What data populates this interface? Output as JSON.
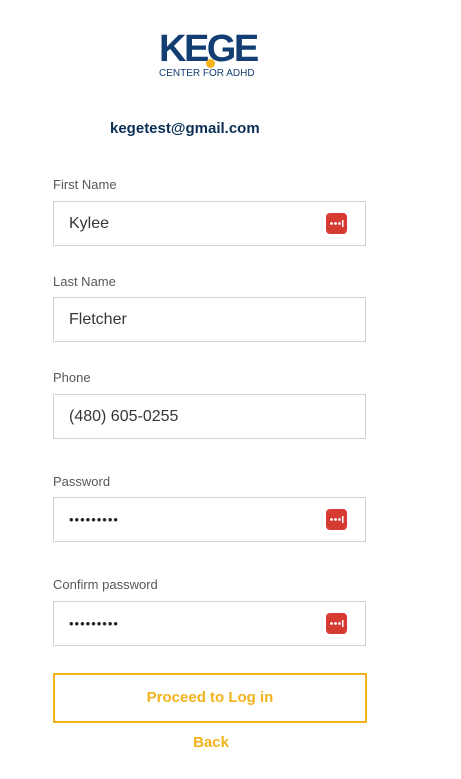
{
  "brand": {
    "logo_word": "KEGE",
    "logo_subtitle": "CENTER FOR ADHD",
    "logo_color": "#123e73",
    "dot_color": "#f4b41a"
  },
  "account": {
    "email": "kegetest@gmail.com"
  },
  "form": {
    "first_name": {
      "label": "First Name",
      "value": "Kylee",
      "has_password_manager_icon": true
    },
    "last_name": {
      "label": "Last Name",
      "value": "Fletcher"
    },
    "phone": {
      "label": "Phone",
      "value": "(480) 605-0255"
    },
    "password": {
      "label": "Password",
      "value": "•••••••••",
      "has_password_manager_icon": true
    },
    "confirm_password": {
      "label": "Confirm password",
      "value": "•••••••••",
      "has_password_manager_icon": true
    }
  },
  "actions": {
    "proceed_label": "Proceed to Log in",
    "back_label": "Back",
    "accent_color": "#f2b21b"
  },
  "icons": {
    "password_manager": "password-manager-icon"
  }
}
